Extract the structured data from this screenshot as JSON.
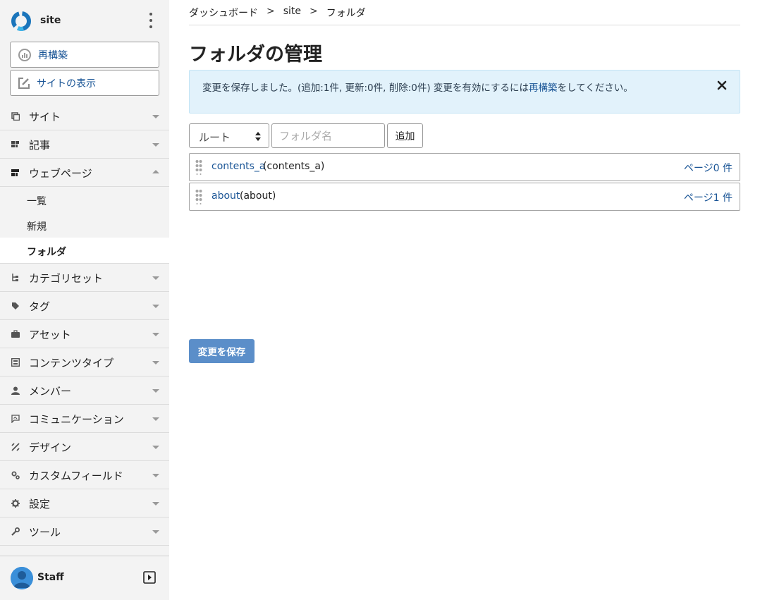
{
  "site": {
    "name": "site"
  },
  "sidebar": {
    "rebuild_label": "再構築",
    "view_site_label": "サイトの表示",
    "menu": [
      {
        "label": "サイト",
        "icon": "site-icon"
      },
      {
        "label": "記事",
        "icon": "entry-icon"
      },
      {
        "label": "ウェブページ",
        "icon": "webpage-icon",
        "expanded": true
      },
      {
        "label": "カテゴリセット",
        "icon": "category-set-icon"
      },
      {
        "label": "タグ",
        "icon": "tag-icon"
      },
      {
        "label": "アセット",
        "icon": "asset-icon"
      },
      {
        "label": "コンテンツタイプ",
        "icon": "content-type-icon"
      },
      {
        "label": "メンバー",
        "icon": "member-icon"
      },
      {
        "label": "コミュニケーション",
        "icon": "communication-icon"
      },
      {
        "label": "デザイン",
        "icon": "design-icon"
      },
      {
        "label": "カスタムフィールド",
        "icon": "custom-field-icon"
      },
      {
        "label": "設定",
        "icon": "gear-icon"
      },
      {
        "label": "ツール",
        "icon": "wrench-icon"
      }
    ],
    "webpage_sub": [
      {
        "label": "一覧"
      },
      {
        "label": "新規"
      },
      {
        "label": "フォルダ",
        "active": true
      }
    ]
  },
  "user": {
    "name": "Staff"
  },
  "breadcrumb": [
    "ダッシュボード",
    "site",
    "フォルダ"
  ],
  "breadcrumb_sep": ">",
  "page_title": "フォルダの管理",
  "alert": {
    "text_before": "変更を保存しました。(追加:1件, 更新:0件, 削除:0件) 変更を有効にするには",
    "link": "再構築",
    "text_after": "をしてください。"
  },
  "controls": {
    "parent_select_value": "ルート",
    "name_placeholder": "フォルダ名",
    "add_label": "追加"
  },
  "folders": [
    {
      "label": "contents_a",
      "basename": "(contents_a)",
      "count": "ページ0 件"
    },
    {
      "label": "about",
      "basename": "(about)",
      "count": "ページ1 件"
    }
  ],
  "save_label": "変更を保存",
  "colors": {
    "accent": "#1a5596",
    "save_button": "#5b8ec9",
    "alert_bg": "#e2f2fb",
    "sidebar_bg": "#f3f3f3"
  }
}
